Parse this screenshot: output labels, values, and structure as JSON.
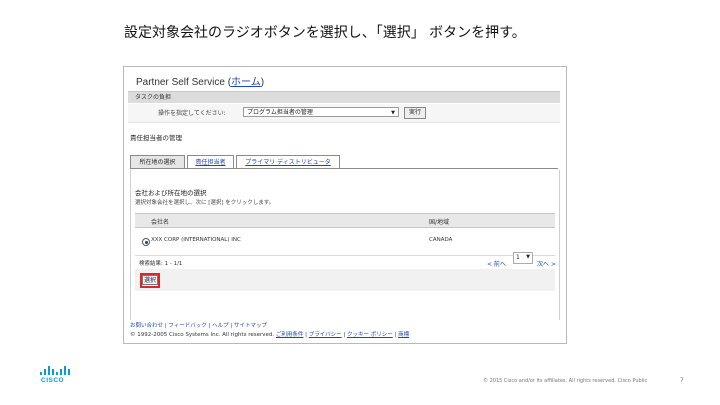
{
  "slide": {
    "title": "設定対象会社のラジオボタンを選択し、「選択」 ボタンを押す。",
    "copyright": "© 2015 Cisco and/or its affiliates. All rights reserved.   Cisco Public",
    "page_number": "7",
    "logo_text": "CISCO"
  },
  "app": {
    "title_prefix": "Partner Self Service (",
    "home_link": "ホーム",
    "title_suffix": ")"
  },
  "task": {
    "header": "タスクの負担",
    "label": "操作を指定してください:",
    "selected_value": "プログラム担当者の管理",
    "go_label": "実行"
  },
  "section": {
    "title": "責任担当者の管理"
  },
  "tabs": [
    {
      "label": "所在地の選択",
      "active": true
    },
    {
      "label": "責任担当者",
      "active": false
    },
    {
      "label": "プライマリ ディストリビュータ",
      "active": false
    }
  ],
  "panel": {
    "title": "会社および所在地の選択",
    "description": "選択対象会社を選択し、次に [選択] をクリックします。",
    "columns": [
      "会社名",
      "国/地域"
    ],
    "rows": [
      {
        "company": "XXX CORP (INTERNATIONAL) INC",
        "country": "CANADA"
      }
    ],
    "result_count": "検索結果: 1 - 1/1",
    "prev_label": "< 前へ",
    "page_value": "1",
    "next_label": "次へ >",
    "select_button": "選択"
  },
  "footer": {
    "links": "お問い合わせ | フィードバック | ヘルプ | サイトマップ",
    "copyright": "© 1992-2005 Cisco Systems Inc. All rights reserved.",
    "terms": "ご利用条件",
    "privacy": "プライバシー",
    "cookie": "クッキー ポリシー",
    "trademark": "商標"
  },
  "colors": {
    "accent_link": "#1a48b7",
    "highlight_red": "#d8282c",
    "cisco_blue": "#049fd9"
  }
}
